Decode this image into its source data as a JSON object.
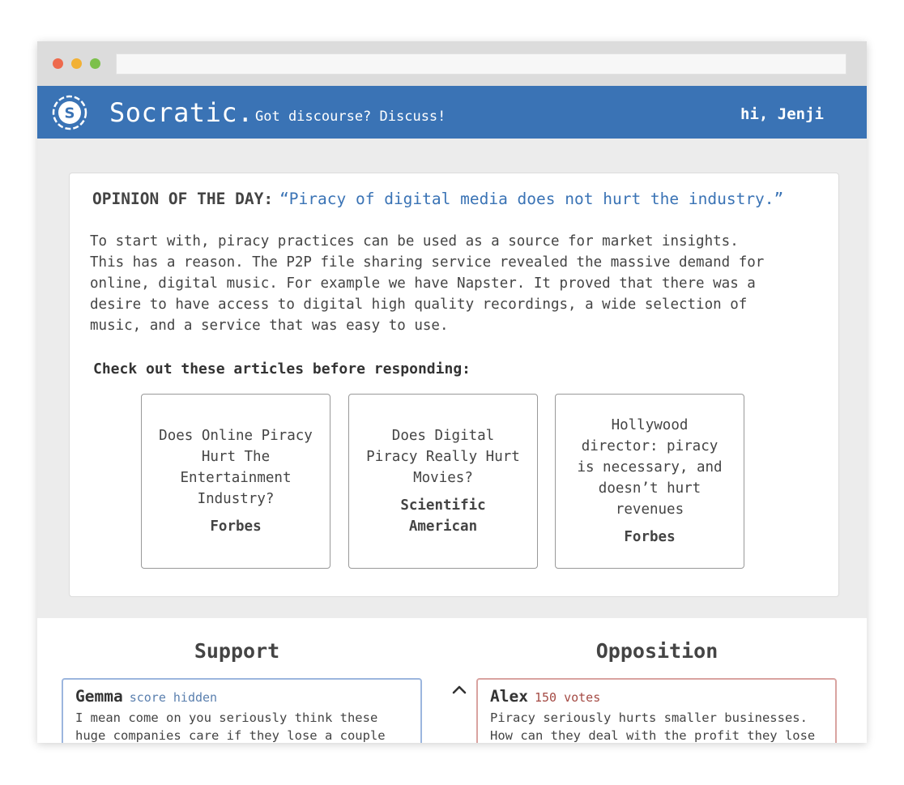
{
  "app": {
    "brand": "Socratic.",
    "tagline": "Got discourse? Discuss!",
    "greeting": "hi, Jenji",
    "logo_letter": "S"
  },
  "opinion": {
    "label": "OPINION OF THE DAY:",
    "quote": "“Piracy of digital media does not hurt the industry.”",
    "body_lines": [
      "To start with, piracy practices can be used as a source for market insights.",
      "This has a reason. The P2P file sharing service revealed the massive demand for",
      "online, digital music. For example we have Napster. It proved that there was a",
      "desire to have access to digital high quality recordings, a wide selection of",
      "music, and a service that was easy to use."
    ]
  },
  "articles": {
    "heading": "Check out these articles before responding:",
    "items": [
      {
        "title": "Does Online Piracy Hurt The Entertainment Industry?",
        "source": "Forbes"
      },
      {
        "title": "Does Digital Piracy Really Hurt Movies?",
        "source": "Scientific American"
      },
      {
        "title": "Hollywood director: piracy is necessary, and doesn’t hurt revenues",
        "source": "Forbes"
      }
    ]
  },
  "columns": {
    "support": "Support",
    "opposition": "Opposition"
  },
  "responses": {
    "support": [
      {
        "name": "Gemma",
        "score": "score hidden",
        "text_lines": [
          "I mean come on you seriously think these",
          "huge companies care if they lose a couple"
        ]
      }
    ],
    "opposition": [
      {
        "name": "Alex",
        "score": "150 votes",
        "text_lines": [
          "Piracy seriously hurts smaller businesses.",
          "How can they deal with the profit they lose"
        ]
      }
    ]
  },
  "colors": {
    "nav": "#3a73b5",
    "quote": "#3a73b5",
    "support_border": "#9cb6de",
    "opposition_border": "#d9a3a0"
  }
}
